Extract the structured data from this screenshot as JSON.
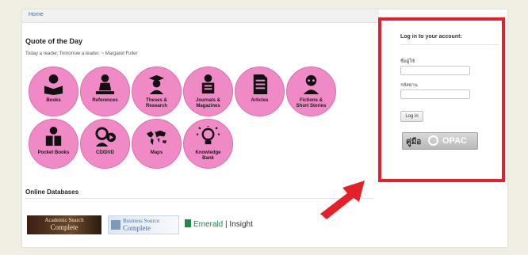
{
  "breadcrumb": "Home",
  "quote": {
    "title": "Quote of the Day",
    "text": "Today a reader, Tomorrow a leader. ~ Margaret Fuller"
  },
  "categories": [
    {
      "label": "Books",
      "icon": "book-reader-icon"
    },
    {
      "label": "References",
      "icon": "reading-person-icon"
    },
    {
      "label": "Theses &\nResearch",
      "icon": "graduate-icon"
    },
    {
      "label": "Journals &\nMagazines",
      "icon": "journal-reader-icon"
    },
    {
      "label": "Articles",
      "icon": "document-icon"
    },
    {
      "label": "Fictions &\nShort Stories",
      "icon": "storyteller-icon"
    },
    {
      "label": "Pocket Books",
      "icon": "pocket-book-icon"
    },
    {
      "label": "CD/DVD",
      "icon": "cd-dvd-icon"
    },
    {
      "label": "Maps",
      "icon": "world-map-icon"
    },
    {
      "label": "Knowledge\nBank",
      "icon": "lightbulb-icon"
    }
  ],
  "online_databases": {
    "title": "Online Databases",
    "items": [
      {
        "line1": "Academic Search",
        "line2": "Complete"
      },
      {
        "line1": "Business Source",
        "line2": "Complete"
      },
      {
        "brand": "Emerald",
        "suffix": "Insight"
      }
    ]
  },
  "login": {
    "title": "Log in to your account:",
    "username_label": "ชื่อผู้ใช้",
    "password_label": "รหัสผ่าน",
    "button": "Log in",
    "opac_prefix": "คู่มือ",
    "opac_text": "OPAC"
  },
  "colors": {
    "category_circle": "#f08ac6",
    "highlight_frame": "#e4202a",
    "arrow": "#e4202a",
    "emerald_brand": "#1d8a4a"
  }
}
